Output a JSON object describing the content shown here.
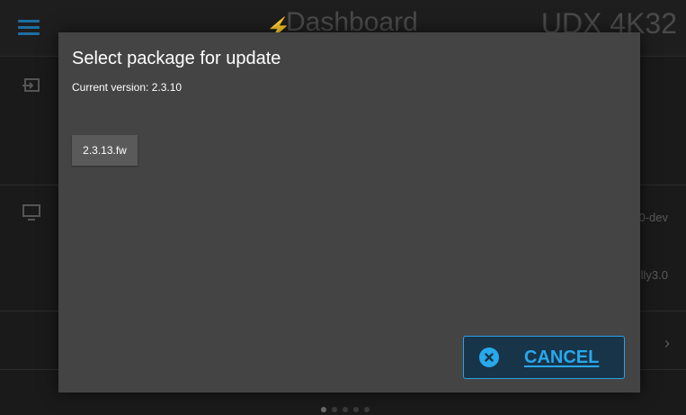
{
  "background": {
    "header_title": "Dashboard",
    "device_name": "UDX 4K32",
    "row_text_1": "0-dev",
    "row_text_2": "lly3.0",
    "chevron": "›"
  },
  "dialog": {
    "title": "Select package for update",
    "current_version": "Current version: 2.3.10",
    "packages": [
      "2.3.13.fw"
    ],
    "cancel_label": "CANCEL"
  },
  "colors": {
    "accent": "#29a8ec",
    "dialog_bg": "#444444",
    "page_bg": "#1a1a1a"
  },
  "icons": {
    "menu": "menu-icon",
    "input": "input-icon",
    "display": "display-icon",
    "cancel": "close-circle-icon"
  }
}
